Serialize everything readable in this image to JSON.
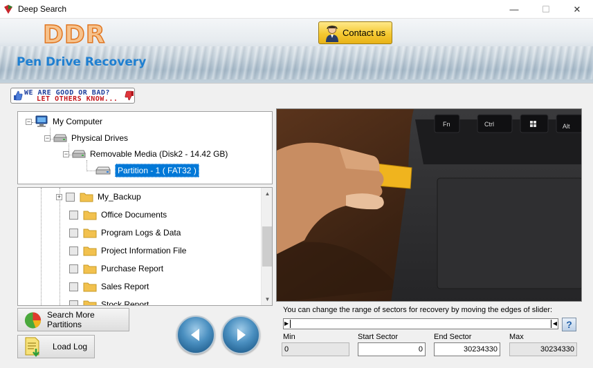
{
  "window": {
    "title": "Deep Search",
    "minimize": "—",
    "maximize": "☐",
    "close": "✕"
  },
  "banner": {
    "logo": "DDR",
    "subtitle": "Pen Drive Recovery",
    "contact_label": "Contact us"
  },
  "feedback": {
    "line1": "WE ARE GOOD OR BAD?",
    "line2": "LET OTHERS KNOW..."
  },
  "tree": {
    "root": "My Computer",
    "physical": "Physical Drives",
    "removable": "Removable Media (Disk2 - 14.42 GB)",
    "partition": "Partition - 1 ( FAT32 )"
  },
  "folders": [
    {
      "label": "My_Backup"
    },
    {
      "label": "Office Documents"
    },
    {
      "label": "Program Logs & Data"
    },
    {
      "label": "Project Information File"
    },
    {
      "label": "Purchase Report"
    },
    {
      "label": "Sales Report"
    },
    {
      "label": "Stock Report"
    }
  ],
  "buttons": {
    "search_more": "Search More Partitions",
    "load_log": "Load Log"
  },
  "slider": {
    "hint": "You can change the range of sectors for recovery by moving the edges of slider:",
    "help": "?",
    "min_label": "Min",
    "min_value": "0",
    "start_label": "Start Sector",
    "start_value": "0",
    "end_label": "End Sector",
    "end_value": "30234330",
    "max_label": "Max",
    "max_value": "30234330"
  },
  "colors": {
    "accent_blue": "#1e7fd1",
    "logo_orange": "#e07520",
    "selection": "#0078d7"
  }
}
